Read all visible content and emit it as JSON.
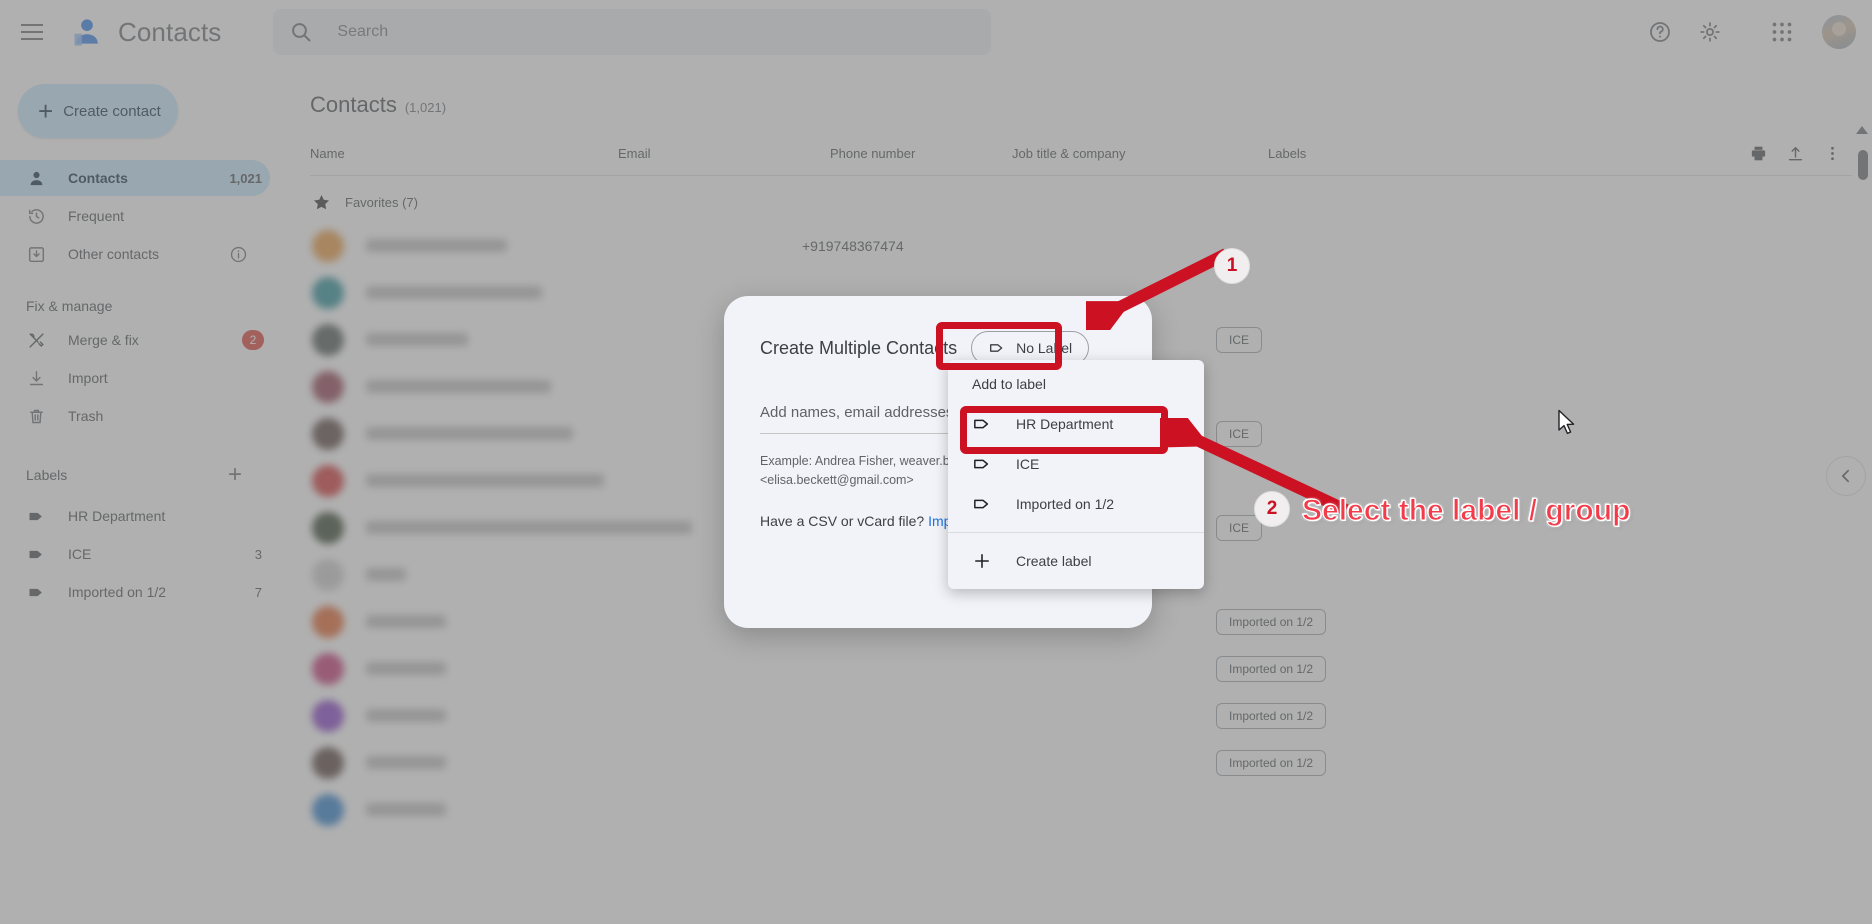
{
  "app": {
    "title": "Contacts",
    "logo_icon": "contacts-person-icon",
    "menu_icon": "hamburger-menu-icon"
  },
  "search": {
    "icon": "search-icon",
    "placeholder": "Search",
    "value": ""
  },
  "topbar_actions": [
    {
      "name": "help-icon",
      "label": "?"
    },
    {
      "name": "settings-gear-icon",
      "label": ""
    },
    {
      "name": "google-apps-grid-icon",
      "label": ""
    },
    {
      "name": "account-avatar",
      "label": ""
    }
  ],
  "sidebar": {
    "create_button": {
      "label": "Create contact",
      "icon": "plus-icon"
    },
    "items": [
      {
        "label": "Contacts",
        "icon": "person-icon",
        "count": "1,021",
        "active": true
      },
      {
        "label": "Frequent",
        "icon": "history-clock-icon",
        "count": "",
        "active": false
      },
      {
        "label": "Other contacts",
        "icon": "archive-download-icon",
        "count": "",
        "active": false,
        "info": true
      }
    ],
    "fix_manage_heading": "Fix & manage",
    "fix_manage_items": [
      {
        "label": "Merge & fix",
        "icon": "merge-tools-icon",
        "badge": "2"
      },
      {
        "label": "Import",
        "icon": "import-download-icon",
        "badge": ""
      },
      {
        "label": "Trash",
        "icon": "trash-icon",
        "badge": ""
      }
    ],
    "labels_heading": "Labels",
    "labels_add_icon": "plus-icon",
    "labels": [
      {
        "label": "HR Department",
        "icon": "label-tag-icon",
        "count": ""
      },
      {
        "label": "ICE",
        "icon": "label-tag-icon",
        "count": "3"
      },
      {
        "label": "Imported on 1/2",
        "icon": "label-tag-icon",
        "count": "7"
      }
    ]
  },
  "main": {
    "page_title": "Contacts",
    "page_count": "(1,021)",
    "columns": [
      "Name",
      "Email",
      "Phone number",
      "Job title & company",
      "Labels"
    ],
    "head_actions": [
      {
        "name": "print-icon"
      },
      {
        "name": "export-upload-icon"
      },
      {
        "name": "more-vertical-icon"
      }
    ],
    "group_row": {
      "icon": "star-icon",
      "label": "Favorites (7)"
    },
    "rows": [
      {
        "avatar": "#e8912f",
        "name_w": 46,
        "phone": "+919748367474",
        "chip": ""
      },
      {
        "avatar": "#13848f",
        "name_w": 62,
        "phone": "",
        "chip": ""
      },
      {
        "avatar": "#3f4a46",
        "name_w": 28,
        "phone": "",
        "chip": "ICE"
      },
      {
        "avatar": "#8b3147",
        "name_w": 66,
        "phone": "",
        "chip": ""
      },
      {
        "avatar": "#4c3632",
        "name_w": 76,
        "phone": "",
        "chip": "ICE"
      },
      {
        "avatar": "#cf2222",
        "name_w": 90,
        "phone": "",
        "chip": ""
      },
      {
        "avatar": "#24361d",
        "name_w": 130,
        "phone": "",
        "chip": "ICE"
      },
      {
        "avatar": "#c9c9c9",
        "name_w": 0,
        "phone": "",
        "chip": ""
      },
      {
        "avatar": "#e2561a",
        "name_w": 18,
        "phone": "",
        "chip": "Imported on 1/2"
      },
      {
        "avatar": "#c2246a",
        "name_w": 18,
        "phone": "",
        "chip": "Imported on 1/2"
      },
      {
        "avatar": "#7b2fc4",
        "name_w": 18,
        "phone": "",
        "chip": "Imported on 1/2"
      },
      {
        "avatar": "#4a342d",
        "name_w": 18,
        "phone": "",
        "chip": "Imported on 1/2"
      },
      {
        "avatar": "#1a73c8",
        "name_w": 18,
        "phone": "",
        "chip": ""
      }
    ],
    "side_toggle_icon": "chevron-left-icon"
  },
  "dialog": {
    "title": "Create Multiple Contacts",
    "label_chip": {
      "label": "No Label",
      "icon": "label-tag-icon"
    },
    "input_placeholder": "Add names, email addresses, or",
    "example_line1": "Example: Andrea Fisher, weaver.blake",
    "example_line2": "<elisa.beckett@gmail.com>",
    "csv_text": "Have a CSV or vCard file?",
    "csv_link": "Impor"
  },
  "menu": {
    "caption": "Add to label",
    "items": [
      {
        "label": "HR Department",
        "icon": "label-tag-icon",
        "highlighted": true
      },
      {
        "label": "ICE",
        "icon": "label-tag-icon",
        "highlighted": false
      },
      {
        "label": "Imported on 1/2",
        "icon": "label-tag-icon",
        "highlighted": false
      }
    ],
    "create_item": {
      "label": "Create label",
      "icon": "plus-icon"
    }
  },
  "annotations": {
    "accent_color": "#cc1122",
    "text_color": "#f33b4a",
    "step1": {
      "number": "1",
      "text": ""
    },
    "step2": {
      "number": "2",
      "text": "Select the label / group"
    }
  }
}
